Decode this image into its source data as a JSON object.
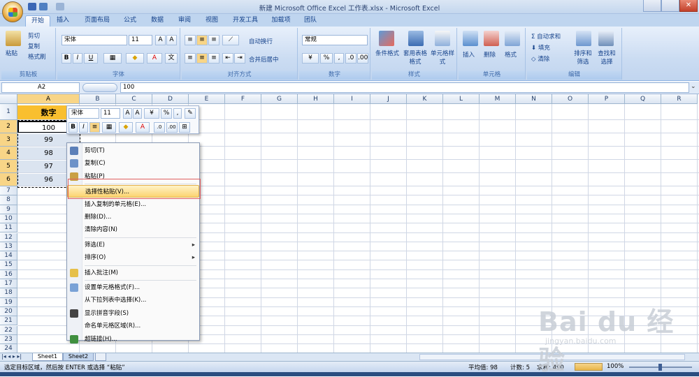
{
  "window": {
    "title": "新建 Microsoft Office Excel 工作表.xlsx - Microsoft Excel"
  },
  "tabs": [
    "开始",
    "插入",
    "页面布局",
    "公式",
    "数据",
    "审阅",
    "视图",
    "开发工具",
    "加载项",
    "团队"
  ],
  "active_tab": "开始",
  "clipboard": {
    "paste": "粘贴",
    "cut": "剪切",
    "copy": "复制",
    "format_painter": "格式刷",
    "label": "剪贴板"
  },
  "font": {
    "name": "宋体",
    "size": "11",
    "label": "字体",
    "bold": "B",
    "italic": "I",
    "underline": "U"
  },
  "alignment": {
    "wrap": "自动换行",
    "merge": "合并后居中",
    "label": "对齐方式"
  },
  "number": {
    "format": "常规",
    "label": "数字"
  },
  "styles": {
    "conditional": "条件格式",
    "table": "套用表格格式",
    "cell_style": "单元格样式",
    "label": "样式"
  },
  "cells": {
    "insert": "插入",
    "delete": "删除",
    "format": "格式",
    "label": "单元格"
  },
  "editing": {
    "autosum": "自动求和",
    "fill": "填充",
    "clear": "清除",
    "sort": "排序和筛选",
    "find": "查找和选择",
    "label": "编辑"
  },
  "formula_bar": {
    "name_box": "A2",
    "fx": "fx",
    "value": "100"
  },
  "columns": [
    "A",
    "B",
    "C",
    "D",
    "E",
    "F",
    "G",
    "H",
    "I",
    "J",
    "K",
    "L",
    "M",
    "N",
    "O",
    "P",
    "Q",
    "R"
  ],
  "rows": [
    "1",
    "2",
    "3",
    "4",
    "5",
    "6",
    "7",
    "8",
    "9",
    "10",
    "11",
    "12",
    "13",
    "14",
    "15",
    "16",
    "17",
    "18",
    "19",
    "20",
    "21",
    "22",
    "23",
    "24"
  ],
  "cell_values": {
    "header": "数字",
    "data": [
      "100",
      "99",
      "98",
      "97",
      "96"
    ]
  },
  "mini_toolbar": {
    "font": "宋体",
    "size": "11",
    "percent": "%",
    "comma": ","
  },
  "context_menu": [
    {
      "label": "剪切(T)",
      "icon": "scissors-icon"
    },
    {
      "label": "复制(C)",
      "icon": "copy-icon"
    },
    {
      "label": "粘贴(P)",
      "icon": "paste-icon"
    },
    {
      "label": "选择性粘贴(V)...",
      "icon": "",
      "highlighted": true
    },
    {
      "label": "插入复制的单元格(E)...",
      "icon": ""
    },
    {
      "label": "删除(D)...",
      "icon": ""
    },
    {
      "label": "清除内容(N)",
      "icon": ""
    },
    {
      "label": "筛选(E)",
      "icon": "",
      "submenu": true
    },
    {
      "label": "排序(O)",
      "icon": "",
      "submenu": true
    },
    {
      "label": "插入批注(M)",
      "icon": "comment-icon"
    },
    {
      "label": "设置单元格格式(F)...",
      "icon": "format-cells-icon"
    },
    {
      "label": "从下拉列表中选择(K)...",
      "icon": ""
    },
    {
      "label": "显示拼音字段(S)",
      "icon": "phonetic-icon"
    },
    {
      "label": "命名单元格区域(R)...",
      "icon": ""
    },
    {
      "label": "超链接(H)...",
      "icon": "hyperlink-icon"
    }
  ],
  "sheets": [
    "Sheet1",
    "Sheet2"
  ],
  "status": {
    "message": "选定目标区域，然后按 ENTER 或选择 “粘贴”",
    "average": "平均值: 98",
    "count": "计数: 5",
    "sum": "求和: 490",
    "zoom": "100%"
  },
  "watermark": {
    "brand": "Bai du 经验",
    "url": "jingyan.baidu.com"
  },
  "colors": {
    "header_cell": "#f9bf2f",
    "data_cell": "#dbe4f0",
    "highlight": "#fbd36f",
    "ribbon": "#cbdcf2"
  }
}
